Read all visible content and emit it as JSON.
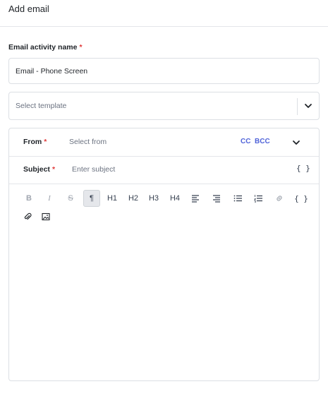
{
  "header": {
    "title": "Add email"
  },
  "form": {
    "name_label": "Email activity name",
    "required_mark": "*",
    "name_value": "Email - Phone Screen",
    "template_placeholder": "Select template"
  },
  "composer": {
    "from_label": "From",
    "from_placeholder": "Select from",
    "cc": "CC",
    "bcc": "BCC",
    "subject_label": "Subject",
    "subject_placeholder": "Enter subject",
    "variables_glyph": "{ }",
    "toolbar": {
      "bold": "B",
      "italic": "I",
      "strike": "S",
      "paragraph": "¶",
      "h1": "H1",
      "h2": "H2",
      "h3": "H3",
      "h4": "H4",
      "variables": "{ }"
    }
  },
  "icons": [
    "chevron-down-icon",
    "align-left-icon",
    "align-right-icon",
    "bullet-list-icon",
    "numbered-list-icon",
    "link-icon",
    "attachment-icon",
    "image-icon"
  ],
  "colors": {
    "required": "#e03a3a",
    "accent": "#4f63d9",
    "border": "#dcdfe4"
  }
}
